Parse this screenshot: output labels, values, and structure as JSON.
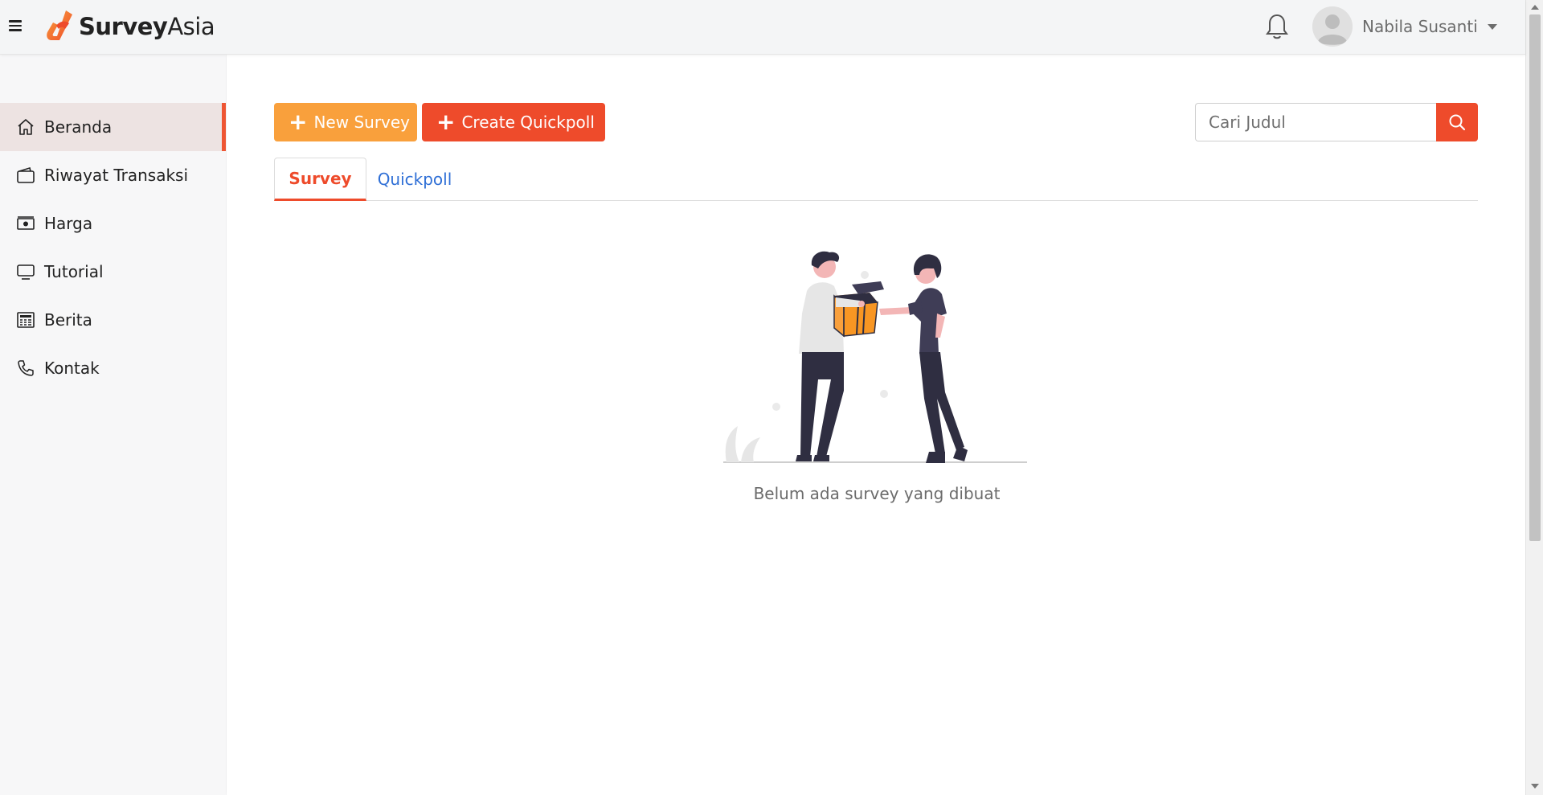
{
  "app": {
    "logo_bold": "Survey",
    "logo_light": "Asia"
  },
  "header": {
    "user_name": "Nabila Susanti"
  },
  "sidebar": {
    "items": [
      {
        "label": "Beranda",
        "icon": "home-icon",
        "active": true
      },
      {
        "label": "Riwayat Transaksi",
        "icon": "wallet-icon",
        "active": false
      },
      {
        "label": "Harga",
        "icon": "money-icon",
        "active": false
      },
      {
        "label": "Tutorial",
        "icon": "monitor-icon",
        "active": false
      },
      {
        "label": "Berita",
        "icon": "newspaper-icon",
        "active": false
      },
      {
        "label": "Kontak",
        "icon": "phone-icon",
        "active": false
      }
    ]
  },
  "toolbar": {
    "new_survey_label": "New Survey",
    "create_quickpoll_label": "Create Quickpoll",
    "search_placeholder": "Cari Judul"
  },
  "tabs": {
    "survey_label": "Survey",
    "quickpoll_label": "Quickpoll",
    "active": "Survey"
  },
  "empty_state": {
    "message": "Belum ada survey yang dibuat"
  },
  "colors": {
    "accent": "#ee4b2b",
    "secondary": "#f9a03c",
    "link": "#2f6fd6",
    "active_bg": "#ede3e2"
  }
}
